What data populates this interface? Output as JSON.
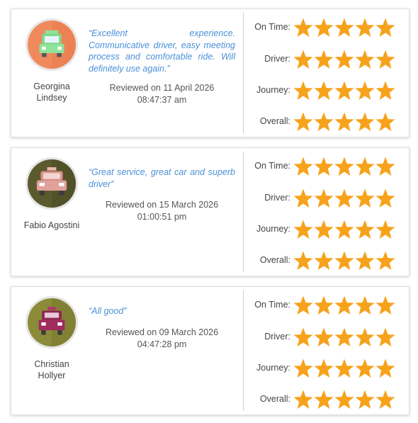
{
  "colors": {
    "star": "#f7a21b",
    "quote": "#4a90d9"
  },
  "reviews": [
    {
      "avatar_icon": "green-taxi-icon",
      "name_line1": "Georgina",
      "name_line2": "Lindsey",
      "quote": "“Excellent experience. Communicative driver, easy meeting process and comfortable ride. Will definitely use again.”",
      "reviewed_line1": "Reviewed on 11 April 2026",
      "reviewed_line2": "08:47:37 am",
      "ratings": [
        {
          "label": "On Time:",
          "stars": 5
        },
        {
          "label": "Driver:",
          "stars": 5
        },
        {
          "label": "Journey:",
          "stars": 5
        },
        {
          "label": "Overall:",
          "stars": 5
        }
      ]
    },
    {
      "avatar_icon": "pink-taxi-icon",
      "name_line1": "Fabio Agostini",
      "name_line2": "",
      "quote": "“Great service, great car and superb driver”",
      "reviewed_line1": "Reviewed on 15 March 2026",
      "reviewed_line2": "01:00:51 pm",
      "ratings": [
        {
          "label": "On Time:",
          "stars": 5
        },
        {
          "label": "Driver:",
          "stars": 5
        },
        {
          "label": "Journey:",
          "stars": 5
        },
        {
          "label": "Overall:",
          "stars": 5
        }
      ]
    },
    {
      "avatar_icon": "maroon-taxi-icon",
      "name_line1": "Christian",
      "name_line2": "Hollyer",
      "quote": "“All good”",
      "reviewed_line1": "Reviewed on 09 March 2026",
      "reviewed_line2": "04:47:28 pm",
      "ratings": [
        {
          "label": "On Time:",
          "stars": 5
        },
        {
          "label": "Driver:",
          "stars": 5
        },
        {
          "label": "Journey:",
          "stars": 5
        },
        {
          "label": "Overall:",
          "stars": 5
        }
      ]
    }
  ]
}
